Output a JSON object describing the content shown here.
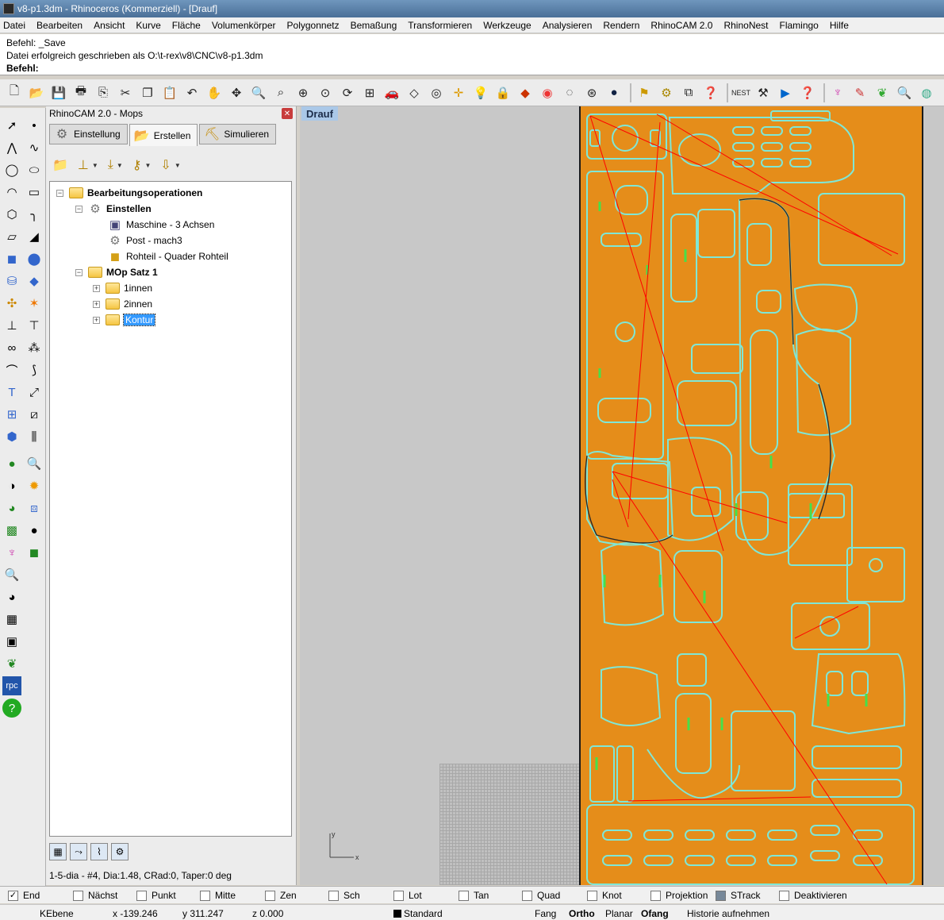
{
  "window": {
    "title": "v8-p1.3dm - Rhinoceros (Kommerziell) - [Drauf]"
  },
  "menu": [
    "Datei",
    "Bearbeiten",
    "Ansicht",
    "Kurve",
    "Fläche",
    "Volumenkörper",
    "Polygonnetz",
    "Bemaßung",
    "Transformieren",
    "Werkzeuge",
    "Analysieren",
    "Rendern",
    "RhinoCAM 2.0",
    "RhinoNest",
    "Flamingo",
    "Hilfe"
  ],
  "command": {
    "history": [
      "Befehl: _Save",
      "Datei erfolgreich geschrieben als O:\\t-rex\\v8\\CNC\\v8-p1.3dm"
    ],
    "prompt": "Befehl:",
    "value": ""
  },
  "toolbar_icons": [
    "new-file-icon",
    "open-file-icon",
    "save-icon",
    "print-icon",
    "export-icon",
    "cut-icon",
    "copy-icon",
    "paste-icon",
    "undo-icon",
    "pan-hand-icon",
    "move-view-icon",
    "zoom-icon",
    "zoom-window-icon",
    "zoom-extents-icon",
    "zoom-selected-icon",
    "rotate-view-icon",
    "four-viewports-icon",
    "car-icon",
    "cplane-icon",
    "point-snap-icon",
    "gumball-icon",
    "light-bulb-icon",
    "lock-icon",
    "layer-icon",
    "color-wheel-icon",
    "sphere-wire-icon",
    "mesh-sphere-icon",
    "render-sphere-icon",
    "options-icon",
    "gear-icon",
    "transform-icon",
    "help-icon",
    "nest-icon",
    "tool-icon",
    "play-icon",
    "help2-icon",
    "flamingo-icon",
    "brush-icon",
    "leaf-icon",
    "search-icon",
    "globe-icon"
  ],
  "panel": {
    "title": "RhinoCAM 2.0 - Mops",
    "tabs": [
      "Einstellung",
      "Erstellen",
      "Simulieren"
    ],
    "active_tab": "Erstellen",
    "tree": {
      "root": "Bearbeitungsoperationen",
      "setup": "Einstellen",
      "machine": "Maschine - 3 Achsen",
      "post": "Post - mach3",
      "stock": "Rohteil - Quader Rohteil",
      "mop_set": "MOp Satz 1",
      "ops": [
        "1innen",
        "2innen",
        "Kontur"
      ],
      "selected": "Kontur"
    },
    "tool_info": "1-5-dia - #4, Dia:1.48, CRad:0, Taper:0 deg"
  },
  "viewport": {
    "label": "Drauf",
    "axis_x": "x",
    "axis_y": "y",
    "stock_color": "#e58d1a",
    "toolpath_color": "#7fe7d6",
    "rapid_color": "#ff0000"
  },
  "osnaps": [
    {
      "label": "End",
      "checked": true
    },
    {
      "label": "Nächst",
      "checked": false
    },
    {
      "label": "Punkt",
      "checked": false
    },
    {
      "label": "Mitte",
      "checked": false
    },
    {
      "label": "Zen",
      "checked": false
    },
    {
      "label": "Sch",
      "checked": false
    },
    {
      "label": "Lot",
      "checked": false
    },
    {
      "label": "Tan",
      "checked": false
    },
    {
      "label": "Quad",
      "checked": false
    },
    {
      "label": "Knot",
      "checked": false
    },
    {
      "label": "Projektion",
      "checked": false
    },
    {
      "label": "STrack",
      "checked": false
    },
    {
      "label": "Deaktivieren",
      "checked": false
    }
  ],
  "status": {
    "cplane": "KEbene",
    "x": "x -139.246",
    "y": "y 311.247",
    "z": "z 0.000",
    "layer": "Standard",
    "fang": "Fang",
    "ortho": "Ortho",
    "planar": "Planar",
    "ofang": "Ofang",
    "history": "Historie aufnehmen"
  }
}
